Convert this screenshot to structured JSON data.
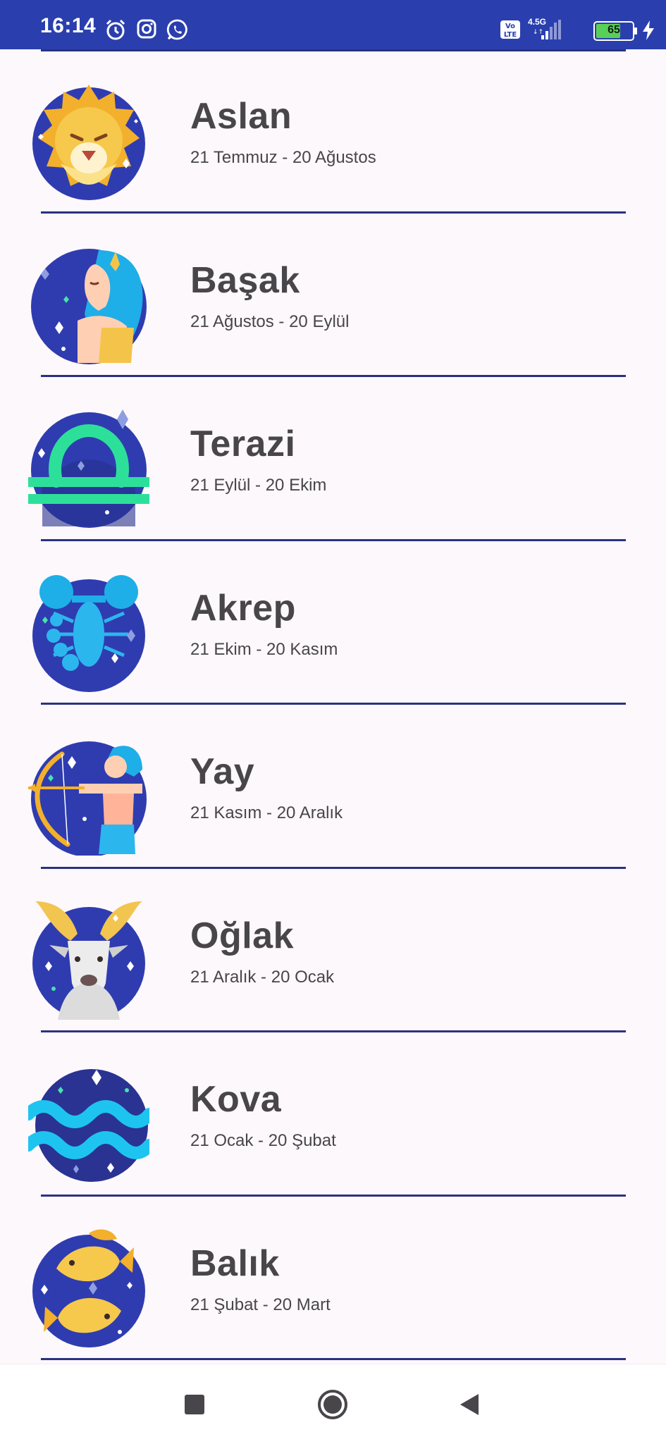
{
  "status_bar": {
    "time": "16:14",
    "network": "4.5G",
    "volte": "Vo LTE",
    "battery": "65",
    "background": "#2a3fad"
  },
  "signs": [
    {
      "name": "Aslan",
      "dates": "21 Temmuz - 20 Ağustos",
      "icon": "lion-icon"
    },
    {
      "name": "Başak",
      "dates": "21 Ağustos - 20 Eylül",
      "icon": "virgo-icon"
    },
    {
      "name": "Terazi",
      "dates": "21 Eylül - 20 Ekim",
      "icon": "libra-icon"
    },
    {
      "name": "Akrep",
      "dates": "21 Ekim - 20 Kasım",
      "icon": "scorpion-icon"
    },
    {
      "name": "Yay",
      "dates": "21 Kasım - 20 Aralık",
      "icon": "archer-icon"
    },
    {
      "name": "Oğlak",
      "dates": "21 Aralık - 20 Ocak",
      "icon": "goat-icon"
    },
    {
      "name": "Kova",
      "dates": "21 Ocak - 20 Şubat",
      "icon": "aquarius-icon"
    },
    {
      "name": "Balık",
      "dates": "21 Şubat - 20 Mart",
      "icon": "fish-icon"
    }
  ],
  "colors": {
    "accent": "#2a3fad",
    "divider": "#2a3280",
    "text": "#48464a",
    "background": "#fdf8fb"
  }
}
